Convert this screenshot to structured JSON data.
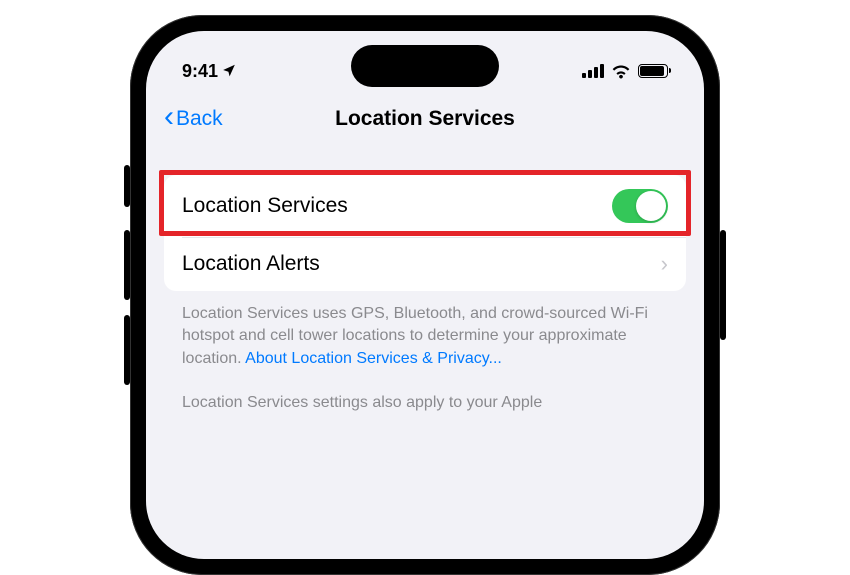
{
  "status": {
    "time": "9:41"
  },
  "nav": {
    "back_label": "Back",
    "title": "Location Services"
  },
  "settings": {
    "rows": [
      {
        "label": "Location Services",
        "toggle_on": true
      },
      {
        "label": "Location Alerts"
      }
    ]
  },
  "footer": {
    "text1": "Location Services uses GPS, Bluetooth, and crowd-sourced Wi-Fi hotspot and cell tower locations to determine your approximate location. ",
    "link": "About Location Services & Privacy...",
    "text2": "Location Services settings also apply to your Apple"
  }
}
